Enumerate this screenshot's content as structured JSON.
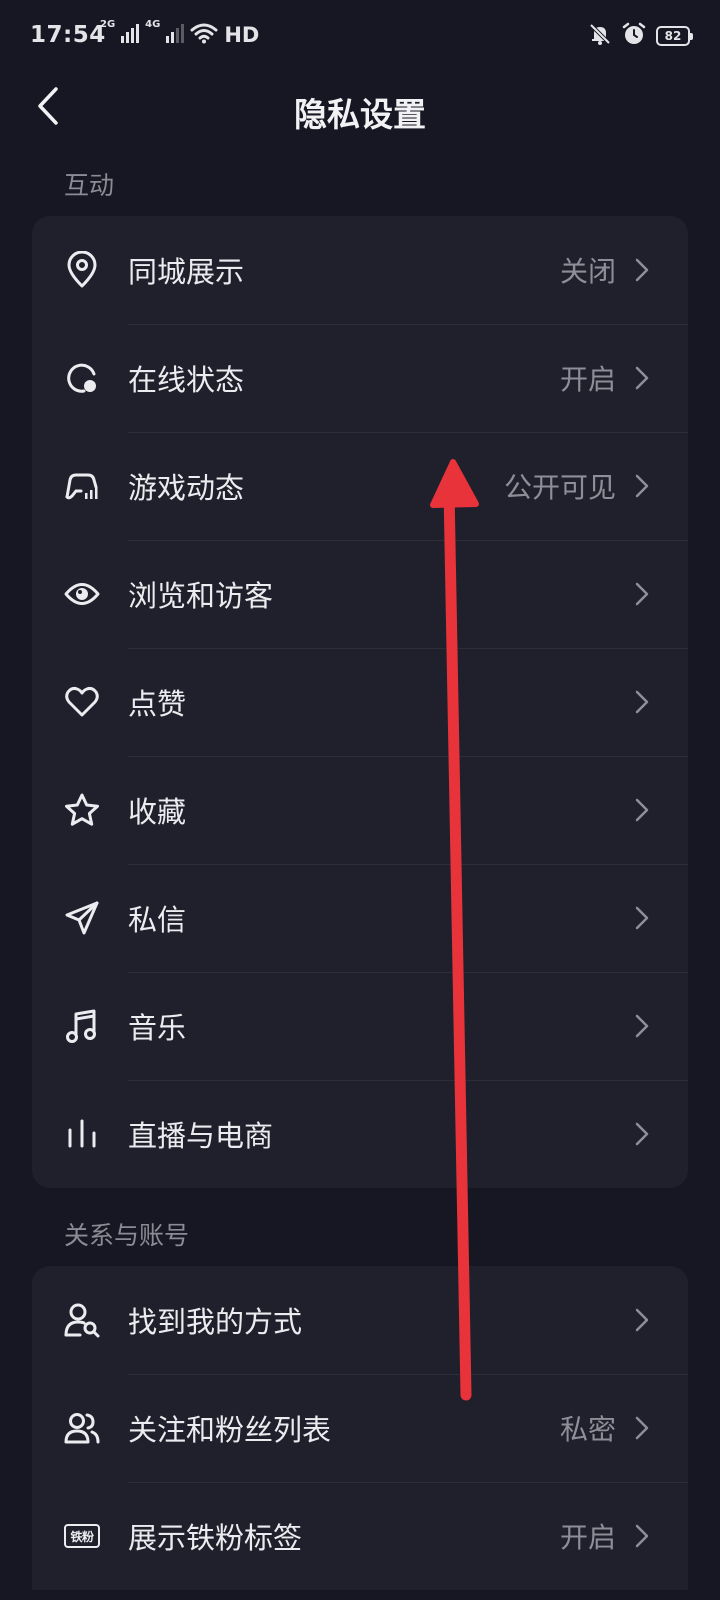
{
  "status_bar": {
    "time": "17:54",
    "network_1": "2G",
    "network_2": "4G",
    "hd_label": "HD",
    "battery": "82",
    "icons": [
      "signal-icon",
      "wifi-icon",
      "bell-off-icon",
      "alarm-icon",
      "battery-icon"
    ]
  },
  "header": {
    "title": "隐私设置",
    "back_icon": "chevron-left-icon"
  },
  "sections": {
    "interaction": {
      "title": "互动",
      "items": [
        {
          "label": "同城展示",
          "value": "关闭",
          "icon": "location-pin-icon"
        },
        {
          "label": "在线状态",
          "value": "开启",
          "icon": "online-status-icon"
        },
        {
          "label": "游戏动态",
          "value": "公开可见",
          "icon": "game-controller-icon"
        },
        {
          "label": "浏览和访客",
          "value": "",
          "icon": "eye-icon"
        },
        {
          "label": "点赞",
          "value": "",
          "icon": "heart-icon"
        },
        {
          "label": "收藏",
          "value": "",
          "icon": "star-icon"
        },
        {
          "label": "私信",
          "value": "",
          "icon": "send-icon"
        },
        {
          "label": "音乐",
          "value": "",
          "icon": "music-note-icon"
        },
        {
          "label": "直播与电商",
          "value": "",
          "icon": "live-bars-icon"
        }
      ]
    },
    "relations": {
      "title": "关系与账号",
      "items": [
        {
          "label": "找到我的方式",
          "value": "",
          "icon": "user-search-icon"
        },
        {
          "label": "关注和粉丝列表",
          "value": "私密",
          "icon": "users-icon"
        },
        {
          "label": "展示铁粉标签",
          "value": "开启",
          "icon": "tiefen-badge-icon",
          "badge_text": "铁粉"
        }
      ]
    }
  },
  "overlay": {
    "swipe_arrow_color": "#e8333a"
  }
}
